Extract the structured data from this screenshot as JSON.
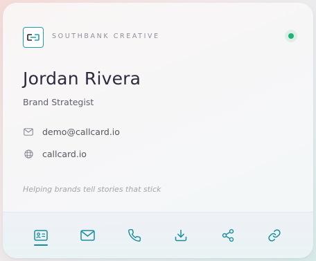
{
  "company": {
    "name": "SOUTHBANK CREATIVE"
  },
  "profile": {
    "name": "Jordan Rivera",
    "title": "Brand Strategist",
    "email": "demo@callcard.io",
    "website": "callcard.io",
    "tagline": "Helping brands tell stories that stick"
  },
  "status": {
    "color": "#20b177"
  },
  "theme": {
    "accent": "#198c99"
  },
  "actions": [
    {
      "icon": "contact-card-icon",
      "active": true
    },
    {
      "icon": "mail-icon",
      "active": false
    },
    {
      "icon": "phone-icon",
      "active": false
    },
    {
      "icon": "download-icon",
      "active": false
    },
    {
      "icon": "share-icon",
      "active": false
    },
    {
      "icon": "link-icon",
      "active": false
    }
  ]
}
